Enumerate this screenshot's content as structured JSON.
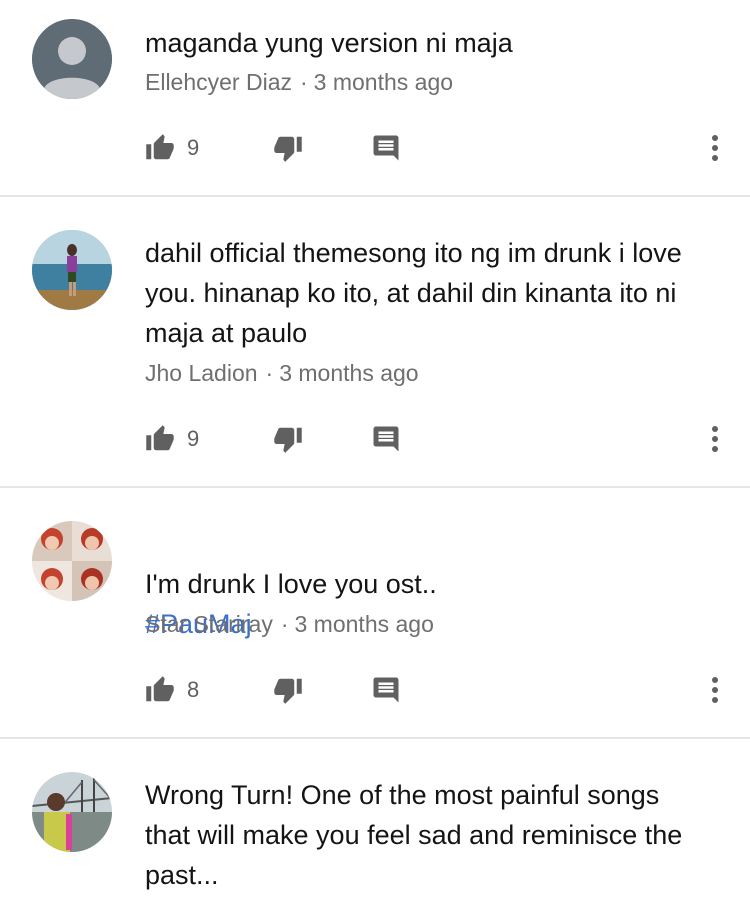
{
  "comments": [
    {
      "text": "maganda yung version ni maja",
      "author": "Ellehcyer Diaz",
      "time": "3 months ago",
      "likes": "9",
      "avatar": "default-avatar"
    },
    {
      "text": "dahil official themesong ito ng im drunk i love\nyou. hinanap ko ito, at dahil din kinanta ito ni\nmaja at paulo",
      "author": "Jho Ladion",
      "time": "3 months ago",
      "likes": "9",
      "avatar": "photo-avatar-sea"
    },
    {
      "text": "I'm drunk I love you ost..",
      "hashtag": "#PauMaj",
      "author": "Star Stariray",
      "time": "3 months ago",
      "likes": "8",
      "avatar": "photo-avatar-collage"
    },
    {
      "text": "Wrong Turn! One of the most painful songs\nthat will make you feel sad and reminisce the\npast...",
      "author": "",
      "time": "",
      "likes": "",
      "avatar": "photo-avatar-bridge"
    }
  ],
  "meta_separator": "·",
  "colors": {
    "text": "#141414",
    "meta": "#6f6f6f",
    "hashtag": "#3a6fd0",
    "icon": "#606060",
    "divider": "#e5e5e5"
  }
}
